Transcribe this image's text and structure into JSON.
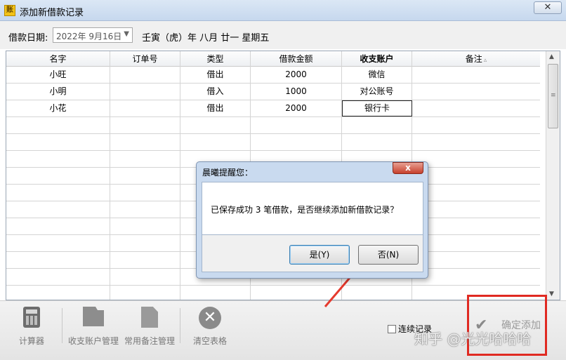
{
  "window": {
    "title": "添加新借款记录",
    "app_icon_text": "账",
    "close_glyph": "✕"
  },
  "date": {
    "label": "借款日期:",
    "value": "2022年 9月16日",
    "lunar": "壬寅（虎）年 八月 廿一 星期五"
  },
  "grid": {
    "columns": [
      {
        "label": "名字"
      },
      {
        "label": "订单号"
      },
      {
        "label": "类型"
      },
      {
        "label": "借款金额"
      },
      {
        "label": "收支账户"
      },
      {
        "label": "备注",
        "sort_indicator": "▵"
      }
    ],
    "rows": [
      {
        "name": "小旺",
        "order": "",
        "type": "借出",
        "amount": "2000",
        "account": "微信",
        "note": ""
      },
      {
        "name": "小明",
        "order": "",
        "type": "借入",
        "amount": "1000",
        "account": "对公账号",
        "note": ""
      },
      {
        "name": "小花",
        "order": "",
        "type": "借出",
        "amount": "2000",
        "account": "银行卡",
        "note": ""
      }
    ]
  },
  "dialog": {
    "title": "晨曦提醒您：",
    "close_glyph": "x",
    "message": "已保存成功 3 笔借款，是否继续添加新借款记录？",
    "yes_label": "是(Y)",
    "no_label": "否(N)"
  },
  "toolbar": {
    "calculator": "计算器",
    "accounts": "收支账户管理",
    "notes": "常用备注管理",
    "clear": "清空表格",
    "continue_label": "连续记录",
    "confirm_label": "确定添加"
  },
  "watermark": "知乎 @光光哈哈哈",
  "colors": {
    "annotation_red": "#e02a22",
    "title_bar": "#c6d8ee"
  }
}
